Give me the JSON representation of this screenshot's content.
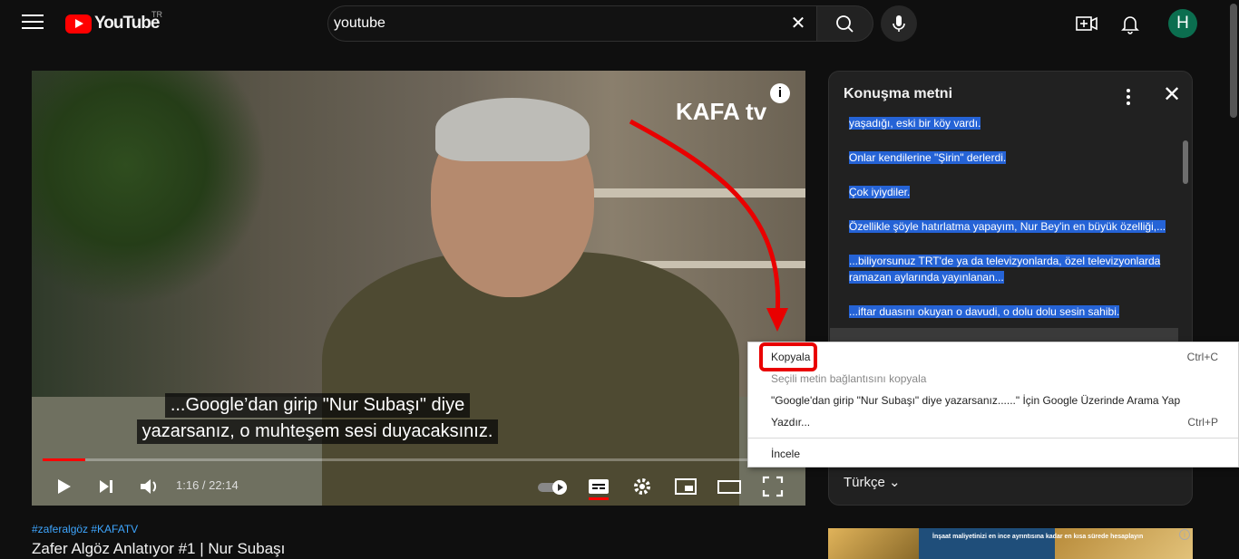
{
  "header": {
    "logo_text": "YouTube",
    "country_code": "TR",
    "search_value": "youtube",
    "avatar_initial": "H"
  },
  "player": {
    "overlay_logo": "KAFA tv",
    "subtitle_line1": "...Google’dan girip \"Nur Subaşı\" diye",
    "subtitle_line2": "yazarsanız, o muhteşem sesi duyacaksınız.",
    "time": "1:16 / 22:14",
    "progress_fraction": 0.057
  },
  "transcript": {
    "title": "Konuşma metni",
    "segments": [
      "yaşadığı, eski bir köy vardı.",
      "Onlar kendilerine \"Şirin\" derlerdi.",
      "Çok iyiydiler.",
      "Özellikle şöyle hatırlatma yapayım, Nur Bey'in en büyük özelliği,...",
      "...biliyorsunuz TRT'de ya da televizyonlarda, özel televizyonlarda ramazan aylarında yayınlanan...",
      "...iftar duasını okuyan o davudi, o dolu dolu sesin sahibi."
    ],
    "language": "Türkçe"
  },
  "context_menu": {
    "copy": "Kopyala",
    "copy_shortcut": "Ctrl+C",
    "copy_link": "Seçili metin bağlantısını kopyala",
    "search_google": "\"Google'dan girip \"Nur Subaşı\" diye yazarsanız......\" İçin Google Üzerinde Arama Yap",
    "print": "Yazdır...",
    "print_shortcut": "Ctrl+P",
    "inspect": "İncele"
  },
  "below": {
    "hashtags": "#zaferalgöz #KAFATV",
    "title": "Zafer Algöz Anlatıyor #1 | Nur Subaşı"
  },
  "ad": {
    "text": "İnşaat maliyetinizi en ince ayrıntısına kadar en kısa sürede hesaplayın"
  },
  "colors": {
    "background": "#0f0f0f",
    "selection": "#2563d6",
    "brand_red": "#ff0000",
    "highlight_red": "#e90000",
    "avatar": "#0b6e4f"
  }
}
